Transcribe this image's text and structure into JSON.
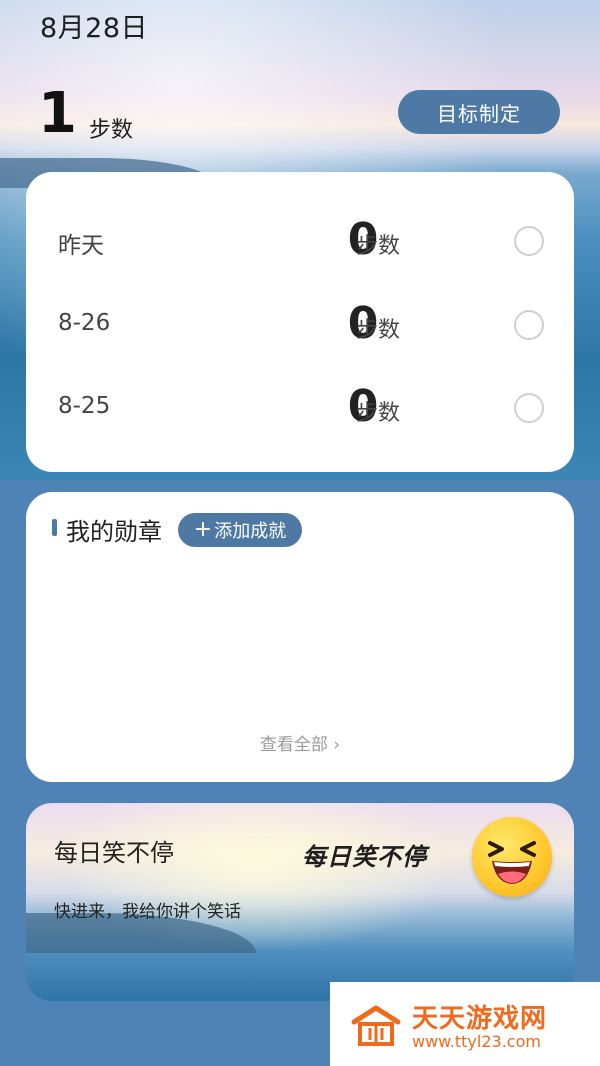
{
  "header": {
    "date": "8月28日",
    "steps_value": "1",
    "steps_unit": "步数",
    "goal_button": "目标制定"
  },
  "history": [
    {
      "label": "昨天",
      "value": "0",
      "unit": "步数"
    },
    {
      "label": "8-26",
      "value": "0",
      "unit": "步数"
    },
    {
      "label": "8-25",
      "value": "0",
      "unit": "步数"
    }
  ],
  "badges": {
    "title": "我的勋章",
    "add_button": "添加成就",
    "view_all": "查看全部 ›"
  },
  "jokes": {
    "title": "每日笑不停",
    "subtitle": "快进来，我给你讲个笑话",
    "logo_text": "每日笑不停"
  },
  "watermark": {
    "title": "天天游戏网",
    "url": "www.ttyl23.com"
  },
  "colors": {
    "accent": "#4f79a5",
    "background": "#4f83b6",
    "watermark": "#f06a1c"
  }
}
